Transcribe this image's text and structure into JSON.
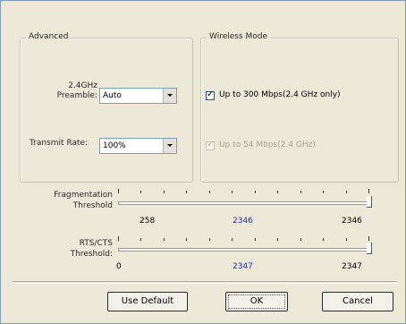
{
  "advanced": {
    "legend": "Advanced",
    "preamble": {
      "label_line1": "2.4GHz",
      "label_line2": "Preamble:",
      "value": "Auto"
    },
    "transmit_rate": {
      "label": "Transmit Rate:",
      "value": "100%"
    }
  },
  "wireless_mode": {
    "legend": "Wireless Mode",
    "option_300": {
      "label": "Up to 300 Mbps(2.4 GHz only)",
      "checked": true,
      "enabled": true
    },
    "option_54": {
      "label": "Up to 54 Mbps(2.4 GHz)",
      "checked": true,
      "enabled": false
    }
  },
  "fragmentation": {
    "label_line1": "Fragmentation",
    "label_line2": "Threshold",
    "min": "258",
    "value": "2346",
    "max": "2346",
    "current_fraction": 1.0
  },
  "rts_cts": {
    "label_line1": "RTS/CTS",
    "label_line2": "Threshold:",
    "min": "0",
    "value": "2347",
    "max": "2347",
    "current_fraction": 1.0
  },
  "buttons": {
    "use_default": "Use Default",
    "ok": "OK",
    "cancel": "Cancel"
  },
  "colors": {
    "accent_value": "#1f32a7",
    "dialog_bg": "#ece9d8"
  }
}
